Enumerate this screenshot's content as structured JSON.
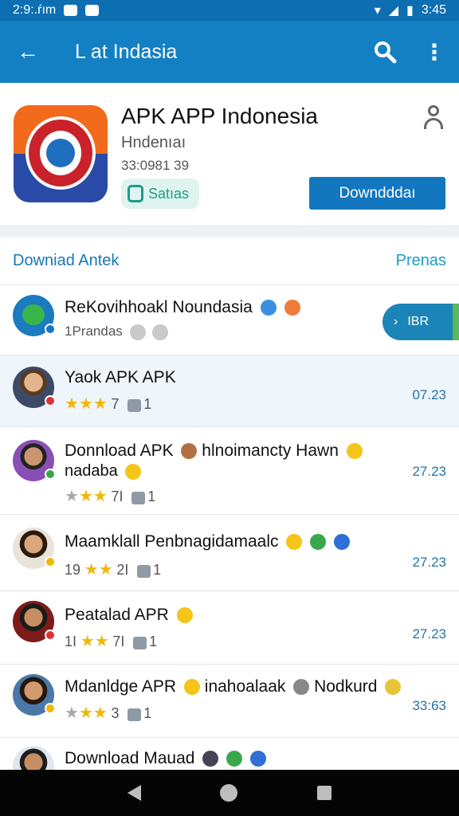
{
  "status_bar": {
    "time": "2:9:.ŕım",
    "clock_right": "3:45"
  },
  "app_bar": {
    "title": "L at Indasia"
  },
  "app": {
    "name": "APK APP Indonesia",
    "publisher": "Hndenıaı",
    "meta": "33:0981 39",
    "status_label": "Satıas",
    "download_label": "Downdddaı"
  },
  "section": {
    "title": "Downiad Antek",
    "link": "Prenas"
  },
  "go_pill": {
    "label": "IBR"
  },
  "list": [
    {
      "title": "ReKovihhoakl Noundasia",
      "sub": "1Prandas",
      "time": "",
      "rating_text": "",
      "count": "",
      "dot": "#1a73c8",
      "emoji1": "#3b8fe0",
      "emoji2": "#f07a3a"
    },
    {
      "title": "Yaok APK APK",
      "sub": "",
      "time": "07.23",
      "rating_text": "7",
      "count": "1",
      "dot": "#d33",
      "emoji1": "",
      "emoji2": ""
    },
    {
      "title": "Donnload APK",
      "title2": "hlnoimancty Hawn",
      "line2": "nadaba",
      "time": "27.23",
      "rating_text": "7I",
      "count": "1",
      "dot": "#3aa84a",
      "emoji1": "#b07040",
      "emoji2": "#f5c518"
    },
    {
      "title": "Maamklall Penbnagidamaalc",
      "sub": "",
      "time": "27.23",
      "rating_text": "19",
      "rating_text2": "2I",
      "count": "1",
      "dot": "#f5b800",
      "emoji1": "#f5c518",
      "emoji2": "#3aa84a"
    },
    {
      "title": "Peatalad APR",
      "sub": "",
      "time": "27.23",
      "rating_text": "1I",
      "rating_text2": "7I",
      "count": "1",
      "dot": "#d33",
      "emoji1": "#f5c518",
      "emoji2": ""
    },
    {
      "title": "Mdanldge APR",
      "title2": "inahoalaak",
      "title3": "Nodkurd",
      "time": "33:63",
      "rating_text": "3",
      "count": "1",
      "dot": "#f5b800",
      "emoji1": "#f5c518",
      "emoji2": "#888"
    },
    {
      "title": "Download Mauad",
      "sub": "",
      "time": "",
      "rating_text": "",
      "count": "",
      "dot": "",
      "emoji1": "#445",
      "emoji2": "#3aa84a"
    }
  ],
  "colors": {
    "primary": "#1480c4",
    "status": "#0d6fb1",
    "accent_teal": "#1e9b86",
    "star": "#f2b705"
  },
  "icons": [
    "back-arrow-icon",
    "search-icon",
    "more-vert-icon",
    "person-icon",
    "lock-icon",
    "chevron-right-icon"
  ]
}
